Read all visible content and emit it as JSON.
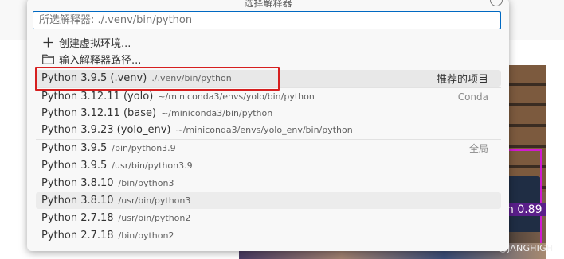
{
  "picker": {
    "title": "选择解释器",
    "input_placeholder": "所选解释器: ./.venv/bin/python",
    "actions": [
      {
        "icon": "plus-icon",
        "label": "创建虚拟环境..."
      },
      {
        "icon": "folder-icon",
        "label": "输入解释器路径..."
      }
    ],
    "items": [
      {
        "name": "Python 3.9.5 (.venv)",
        "path": "./.venv/bin/python",
        "tag": "推荐的项目",
        "selected": true
      },
      {
        "name": "Python 3.12.11 (yolo)",
        "path": "~/miniconda3/envs/yolo/bin/python",
        "tag": "Conda"
      },
      {
        "name": "Python 3.12.11 (base)",
        "path": "~/miniconda3/bin/python",
        "tag": ""
      },
      {
        "name": "Python 3.9.23 (yolo_env)",
        "path": "~/miniconda3/envs/yolo_env/bin/python",
        "tag": ""
      },
      {
        "name": "Python 3.9.5",
        "path": "/bin/python3.9",
        "tag": "全局"
      },
      {
        "name": "Python 3.9.5",
        "path": "/usr/bin/python3.9",
        "tag": ""
      },
      {
        "name": "Python 3.8.10",
        "path": "/bin/python3",
        "tag": ""
      },
      {
        "name": "Python 3.8.10",
        "path": "/usr/bin/python3",
        "tag": ""
      },
      {
        "name": "Python 2.7.18",
        "path": "/usr/bin/python2",
        "tag": ""
      },
      {
        "name": "Python 2.7.18",
        "path": "/bin/python2",
        "tag": ""
      }
    ]
  },
  "background": {
    "detection_label": "n 0.89",
    "watermark": "CSDN @JANGHIGH"
  },
  "colors": {
    "focus_border": "#0069c2",
    "highlight_box": "#d61f1f",
    "detection_box": "#d11ad1"
  }
}
